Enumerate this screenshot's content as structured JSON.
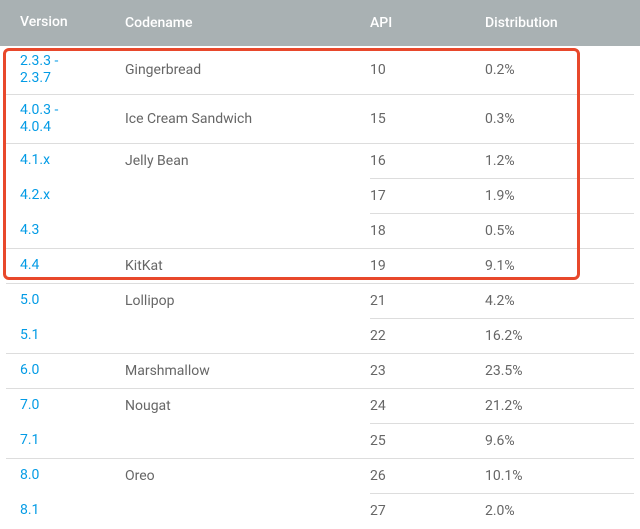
{
  "columns": {
    "version": "Version",
    "codename": "Codename",
    "api": "API",
    "distribution": "Distribution"
  },
  "rows": [
    {
      "version": "2.3.3 -\n2.3.7",
      "codename": "Gingerbread",
      "api": "10",
      "distribution": "0.2%",
      "tall": true,
      "divider_after": "full"
    },
    {
      "version": "4.0.3 -\n4.0.4",
      "codename": "Ice Cream Sandwich",
      "api": "15",
      "distribution": "0.3%",
      "tall": true,
      "divider_after": "full"
    },
    {
      "version": "4.1.x",
      "codename": "Jelly Bean",
      "api": "16",
      "distribution": "1.2%",
      "tall": false,
      "divider_after": "right"
    },
    {
      "version": "4.2.x",
      "codename": "",
      "api": "17",
      "distribution": "1.9%",
      "tall": false,
      "divider_after": "right"
    },
    {
      "version": "4.3",
      "codename": "",
      "api": "18",
      "distribution": "0.5%",
      "tall": false,
      "divider_after": "full"
    },
    {
      "version": "4.4",
      "codename": "KitKat",
      "api": "19",
      "distribution": "9.1%",
      "tall": false,
      "divider_after": "full"
    },
    {
      "version": "5.0",
      "codename": "Lollipop",
      "api": "21",
      "distribution": "4.2%",
      "tall": false,
      "divider_after": "right"
    },
    {
      "version": "5.1",
      "codename": "",
      "api": "22",
      "distribution": "16.2%",
      "tall": false,
      "divider_after": "full"
    },
    {
      "version": "6.0",
      "codename": "Marshmallow",
      "api": "23",
      "distribution": "23.5%",
      "tall": false,
      "divider_after": "full"
    },
    {
      "version": "7.0",
      "codename": "Nougat",
      "api": "24",
      "distribution": "21.2%",
      "tall": false,
      "divider_after": "right"
    },
    {
      "version": "7.1",
      "codename": "",
      "api": "25",
      "distribution": "9.6%",
      "tall": false,
      "divider_after": "full"
    },
    {
      "version": "8.0",
      "codename": "Oreo",
      "api": "26",
      "distribution": "10.1%",
      "tall": false,
      "divider_after": "right"
    },
    {
      "version": "8.1",
      "codename": "",
      "api": "27",
      "distribution": "2.0%",
      "tall": false,
      "divider_after": "none"
    }
  ],
  "highlight": {
    "first_row_index": 0,
    "last_row_index": 5
  }
}
